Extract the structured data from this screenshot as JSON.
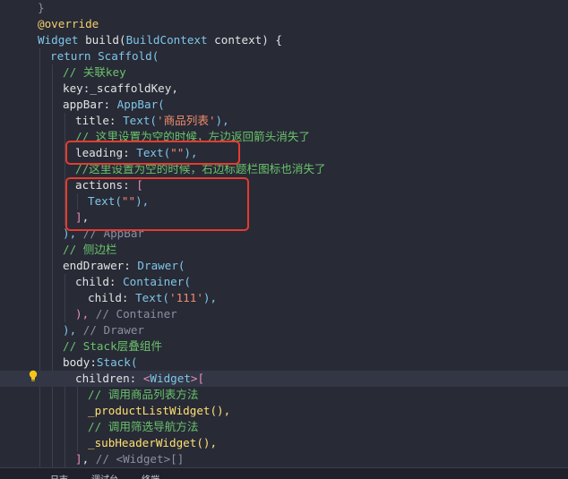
{
  "code": {
    "l0": "}",
    "l1_ann": "@override",
    "l2_a": "Widget",
    "l2_b": " build(",
    "l2_c": "BuildContext",
    "l2_d": " context) {",
    "l3_a": "return",
    "l3_b": "Scaffold(",
    "l4": "// 关联key",
    "l5": "key:_scaffoldKey,",
    "l6_a": "appBar: ",
    "l6_b": "AppBar(",
    "l7_a": "title: ",
    "l7_b": "Text(",
    "l7_c": "'商品列表'",
    "l7_d": "),",
    "l8": "// 这里设置为空的时候，左边返回箭头消失了",
    "l9_a": "leading: ",
    "l9_b": "Text(",
    "l9_c": "\"\"",
    "l9_d": "),",
    "l10": "//这里设置为空的时候，右边标题栏图标也消失了",
    "l11_a": "actions: ",
    "l11_b": "[",
    "l12_a": "Text(",
    "l12_b": "\"\"",
    "l12_c": "),",
    "l13_a": "]",
    "l13_b": ",",
    "l14_a": "), ",
    "l14_b": "// AppBar",
    "l15": "// 侧边栏",
    "l16_a": "endDrawer: ",
    "l16_b": "Drawer(",
    "l17_a": "child: ",
    "l17_b": "Container(",
    "l18_a": "child: ",
    "l18_b": "Text(",
    "l18_c": "'111'",
    "l18_d": "),",
    "l19_a": "), ",
    "l19_b": "// Container",
    "l20_a": "), ",
    "l20_b": "// Drawer",
    "l21": "// Stack层叠组件",
    "l22_a": "body:",
    "l22_b": "Stack(",
    "l23_a": "children: ",
    "l23_b": "<",
    "l23_c": "Widget",
    "l23_d": ">",
    "l23_e": "[",
    "l24": "// 调用商品列表方法",
    "l25": "_productListWidget(),",
    "l26": "// 调用筛选导航方法",
    "l27": "_subHeaderWidget(),",
    "l28_a": "]",
    "l28_b": ", ",
    "l28_c": "// <Widget>[]"
  },
  "gutter_mark": "4",
  "bottom": {
    "item1": "日志",
    "item2": "调试台",
    "item3": "终端"
  },
  "colors": {
    "background": "#282a36",
    "highlight_box": "#e63b2e"
  }
}
